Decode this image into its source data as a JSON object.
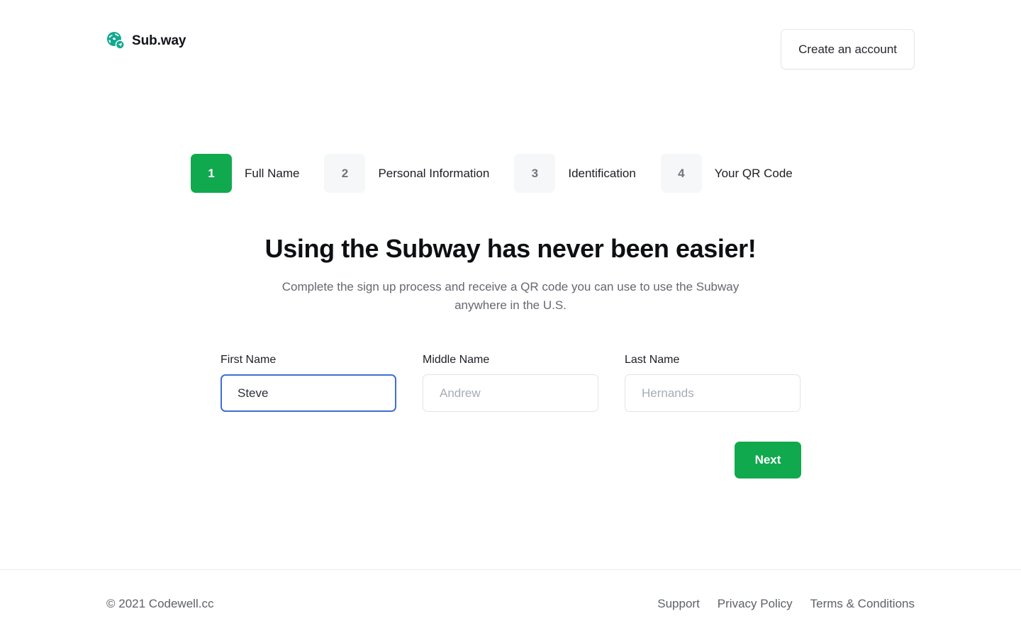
{
  "header": {
    "brand_name": "Sub.way",
    "brand_logo_icon": "globe-location-pin-icon",
    "create_account_label": "Create an account"
  },
  "stepper": {
    "steps": [
      {
        "number": "1",
        "label": "Full Name",
        "state": "active"
      },
      {
        "number": "2",
        "label": "Personal Information",
        "state": "inactive"
      },
      {
        "number": "3",
        "label": "Identification",
        "state": "inactive"
      },
      {
        "number": "4",
        "label": "Your QR Code",
        "state": "inactive"
      }
    ]
  },
  "main": {
    "headline": "Using the Subway has never been easier!",
    "subheadline": "Complete the sign up process and receive a QR code you can use to use the Subway anywhere in the U.S."
  },
  "form": {
    "fields": [
      {
        "label": "First Name",
        "value": "Steve",
        "placeholder": "",
        "focused": true
      },
      {
        "label": "Middle Name",
        "value": "",
        "placeholder": "Andrew",
        "focused": false
      },
      {
        "label": "Last Name",
        "value": "",
        "placeholder": "Hernands",
        "focused": false
      }
    ],
    "next_label": "Next"
  },
  "footer": {
    "copyright": "© 2021 Codewell.cc",
    "links": [
      {
        "label": "Support"
      },
      {
        "label": "Privacy Policy"
      },
      {
        "label": "Terms & Conditions"
      }
    ]
  },
  "colors": {
    "brand_green": "#11a94e",
    "logo_teal": "#13a890",
    "focus_blue": "#3f6fd0",
    "muted_text": "#5e6167",
    "step_inactive_bg": "#f6f7f9"
  }
}
